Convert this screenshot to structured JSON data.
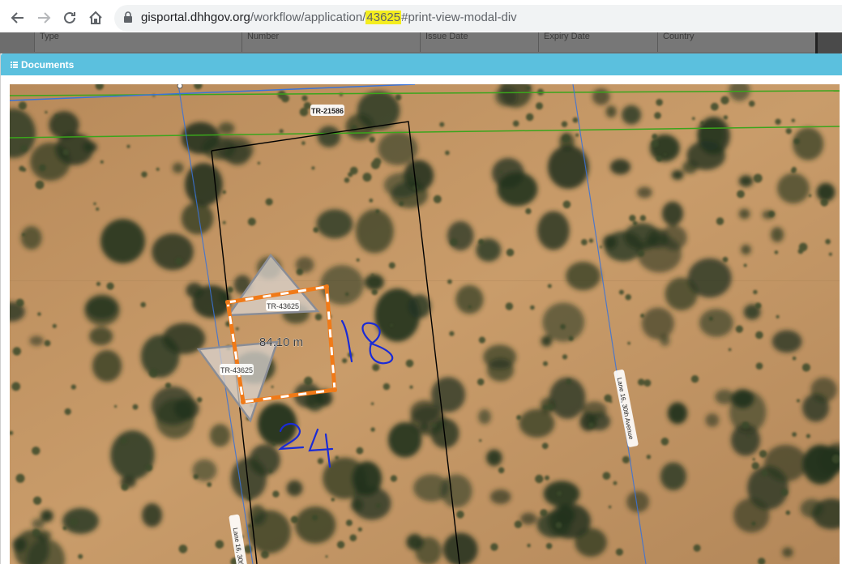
{
  "browser": {
    "url_host": "gisportal.dhhgov.org",
    "url_path": "/workflow/application/",
    "url_highlight": "43625",
    "url_hash": "#print-view-modal-div"
  },
  "background_table": {
    "headers": [
      "Type",
      "Number",
      "Issue Date",
      "Expiry Date",
      "Country"
    ]
  },
  "modal": {
    "title": "Documents"
  },
  "map": {
    "parcel_label_top": "TR-21586",
    "plot_label_upper": "TR-43625",
    "plot_label_lower": "TR-43625",
    "measurement": "84.10 m",
    "road_label_right": "Lane 16, 30th Avenue",
    "road_label_left": "Lane 16, 30th A",
    "handwritten_side": "18",
    "handwritten_bottom": "24"
  },
  "colors": {
    "modal_header": "#5bc0de",
    "plot_outline": "#f07a18",
    "parcel_line": "#000000",
    "road_line": "#3a73d8",
    "boundary_green": "#3aa51c",
    "annotation_ink": "#1a2bd6",
    "url_highlight": "#f4ed1f"
  }
}
